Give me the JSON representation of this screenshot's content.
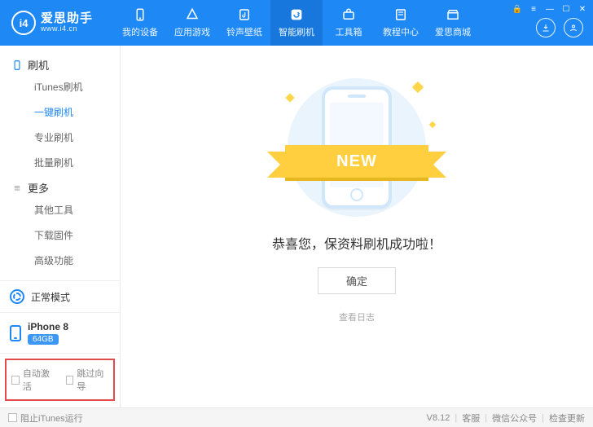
{
  "app": {
    "name": "爱思助手",
    "url": "www.i4.cn",
    "logo_text": "i4"
  },
  "nav": {
    "items": [
      {
        "label": "我的设备",
        "icon": "phone"
      },
      {
        "label": "应用游戏",
        "icon": "apps"
      },
      {
        "label": "铃声壁纸",
        "icon": "music"
      },
      {
        "label": "智能刷机",
        "icon": "flash",
        "active": true
      },
      {
        "label": "工具箱",
        "icon": "toolbox"
      },
      {
        "label": "教程中心",
        "icon": "book"
      },
      {
        "label": "爱思商城",
        "icon": "store"
      }
    ]
  },
  "system_icons": [
    "lock",
    "menu",
    "minimize",
    "maximize",
    "close"
  ],
  "header_right": [
    "download",
    "user"
  ],
  "sidebar": {
    "groups": [
      {
        "title": "刷机",
        "icon": "phone",
        "items": [
          "iTunes刷机",
          "一键刷机",
          "专业刷机",
          "批量刷机"
        ],
        "active_index": 1
      },
      {
        "title": "更多",
        "icon": "more",
        "items": [
          "其他工具",
          "下载固件",
          "高级功能"
        ],
        "active_index": -1
      }
    ],
    "mode": "正常模式",
    "device": {
      "name": "iPhone 8",
      "storage": "64GB"
    },
    "checks": [
      "自动激活",
      "跳过向导"
    ]
  },
  "main": {
    "ribbon": "NEW",
    "message": "恭喜您，保资料刷机成功啦！",
    "confirm": "确定",
    "log_link": "查看日志"
  },
  "footer": {
    "block_itunes": "阻止iTunes运行",
    "version": "V8.12",
    "links": [
      "客服",
      "微信公众号",
      "检查更新"
    ]
  }
}
